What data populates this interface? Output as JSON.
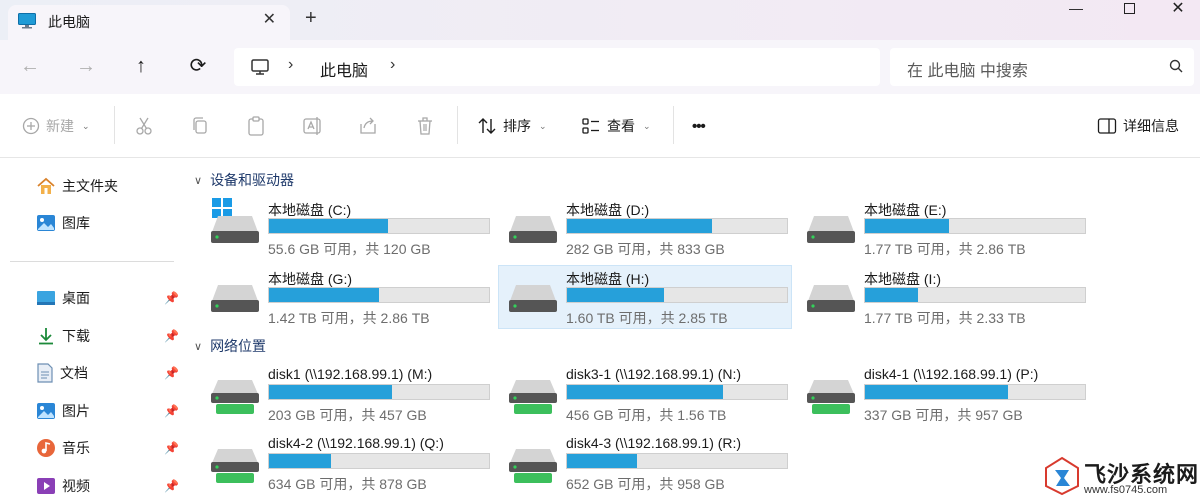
{
  "window": {
    "tab_title": "此电脑",
    "tab_close": "✕",
    "new_tab": "+"
  },
  "nav": {
    "back_icon": "←",
    "forward_icon": "→",
    "up_icon": "↑",
    "refresh_icon": "⟳",
    "breadcrumb_sep": "›",
    "location": "此电脑",
    "search_placeholder": "在 此电脑 中搜索"
  },
  "toolbar": {
    "new_label": "新建",
    "sort_label": "排序",
    "view_label": "查看",
    "more_label": "•••",
    "details_label": "详细信息"
  },
  "sidebar": {
    "items": [
      {
        "label": "主文件夹",
        "icon": "home-icon",
        "pinned": false
      },
      {
        "label": "图库",
        "icon": "gallery-icon",
        "pinned": false
      },
      {
        "label": "桌面",
        "icon": "desktop-icon",
        "pinned": true
      },
      {
        "label": "下载",
        "icon": "download-icon",
        "pinned": true
      },
      {
        "label": "文档",
        "icon": "document-icon",
        "pinned": true
      },
      {
        "label": "图片",
        "icon": "pictures-icon",
        "pinned": true
      },
      {
        "label": "音乐",
        "icon": "music-icon",
        "pinned": true
      },
      {
        "label": "视频",
        "icon": "videos-icon",
        "pinned": true
      }
    ]
  },
  "sections": {
    "devices": "设备和驱动器",
    "network": "网络位置"
  },
  "drives": [
    {
      "name": "本地磁盘 (C:)",
      "info": "55.6 GB 可用，共 120 GB",
      "used_fraction": 0.54
    },
    {
      "name": "本地磁盘 (D:)",
      "info": "282 GB 可用，共 833 GB",
      "used_fraction": 0.66
    },
    {
      "name": "本地磁盘 (E:)",
      "info": "1.77 TB 可用，共 2.86 TB",
      "used_fraction": 0.38
    },
    {
      "name": "本地磁盘 (G:)",
      "info": "1.42 TB 可用，共 2.86 TB",
      "used_fraction": 0.5
    },
    {
      "name": "本地磁盘 (H:)",
      "info": "1.60 TB 可用，共 2.85 TB",
      "used_fraction": 0.44
    },
    {
      "name": "本地磁盘 (I:)",
      "info": "1.77 TB 可用，共 2.33 TB",
      "used_fraction": 0.24
    }
  ],
  "network_drives": [
    {
      "name": "disk1 (\\\\192.168.99.1) (M:)",
      "info": "203 GB 可用，共 457 GB",
      "used_fraction": 0.56
    },
    {
      "name": "disk3-1 (\\\\192.168.99.1) (N:)",
      "info": "456 GB 可用，共 1.56 TB",
      "used_fraction": 0.71
    },
    {
      "name": "disk4-1 (\\\\192.168.99.1) (P:)",
      "info": "337 GB 可用，共 957 GB",
      "used_fraction": 0.65
    },
    {
      "name": "disk4-2 (\\\\192.168.99.1) (Q:)",
      "info": "634 GB 可用，共 878 GB",
      "used_fraction": 0.28
    },
    {
      "name": "disk4-3 (\\\\192.168.99.1) (R:)",
      "info": "652 GB 可用，共 958 GB",
      "used_fraction": 0.32
    }
  ],
  "watermark": {
    "name": "飞沙系统网",
    "url": "www.fs0745.com"
  },
  "colors": {
    "accent": "#26a0da",
    "selection": "#e5f1fb"
  }
}
